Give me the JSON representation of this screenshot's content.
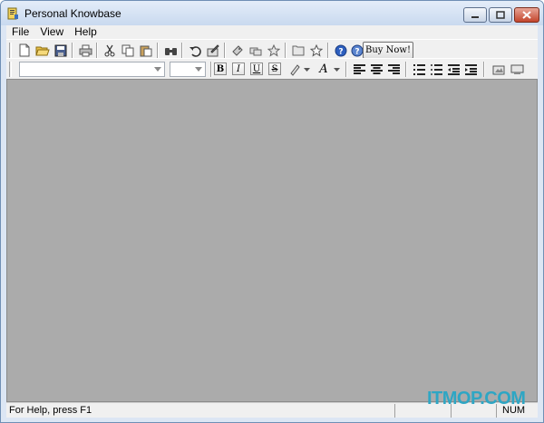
{
  "window": {
    "title": "Personal Knowbase"
  },
  "menu": [
    "File",
    "View",
    "Help"
  ],
  "toolbar": {
    "buy_label": "Buy Now!",
    "icons": [
      "new-document-icon",
      "open-folder-icon",
      "save-icon",
      "print-icon",
      "cut-icon",
      "copy-icon",
      "paste-icon",
      "find-icon",
      "undo-icon",
      "edit-icon",
      "attachments-icon",
      "keywords-icon",
      "star-icon",
      "folder-icon",
      "favorite-star-icon",
      "help-icon",
      "context-help-icon"
    ]
  },
  "format_toolbar": {
    "font_name": "",
    "font_size": "",
    "bold": "B",
    "italic": "I",
    "underline": "U",
    "strike": "S",
    "font_color": "A"
  },
  "status": {
    "text": "For Help, press F1",
    "num": "NUM"
  },
  "watermark": "ITMOP.COM",
  "colors": {
    "client_bg": "#ababab",
    "title_bg": "#dce6f4",
    "close_btn": "#c3452c"
  }
}
